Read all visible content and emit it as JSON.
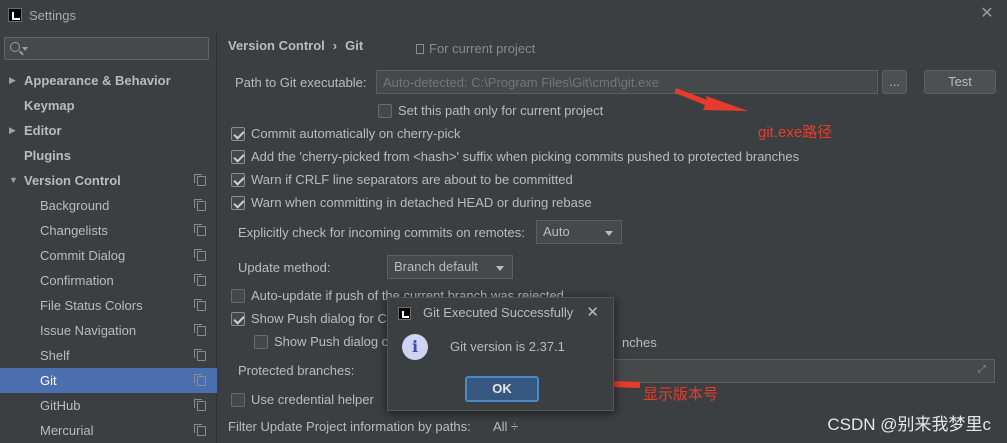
{
  "window": {
    "title": "Settings"
  },
  "search": {
    "placeholder": "",
    "value": ""
  },
  "sidebar": {
    "items": [
      {
        "label": "Appearance & Behavior",
        "bold": true,
        "arrow": "▶",
        "child": false,
        "icon": false
      },
      {
        "label": "Keymap",
        "bold": true,
        "arrow": "",
        "child": false,
        "icon": false
      },
      {
        "label": "Editor",
        "bold": true,
        "arrow": "▶",
        "child": false,
        "icon": false
      },
      {
        "label": "Plugins",
        "bold": true,
        "arrow": "",
        "child": false,
        "icon": false
      },
      {
        "label": "Version Control",
        "bold": true,
        "arrow": "▼",
        "child": false,
        "icon": true
      },
      {
        "label": "Background",
        "bold": false,
        "arrow": "",
        "child": true,
        "icon": true
      },
      {
        "label": "Changelists",
        "bold": false,
        "arrow": "",
        "child": true,
        "icon": true
      },
      {
        "label": "Commit Dialog",
        "bold": false,
        "arrow": "",
        "child": true,
        "icon": true
      },
      {
        "label": "Confirmation",
        "bold": false,
        "arrow": "",
        "child": true,
        "icon": true
      },
      {
        "label": "File Status Colors",
        "bold": false,
        "arrow": "",
        "child": true,
        "icon": true
      },
      {
        "label": "Issue Navigation",
        "bold": false,
        "arrow": "",
        "child": true,
        "icon": true
      },
      {
        "label": "Shelf",
        "bold": false,
        "arrow": "",
        "child": true,
        "icon": true
      },
      {
        "label": "Git",
        "bold": false,
        "arrow": "",
        "child": true,
        "icon": true,
        "selected": true
      },
      {
        "label": "GitHub",
        "bold": false,
        "arrow": "",
        "child": true,
        "icon": true
      },
      {
        "label": "Mercurial",
        "bold": false,
        "arrow": "",
        "child": true,
        "icon": true
      }
    ]
  },
  "breadcrumb": {
    "part1": "Version Control",
    "sep": "›",
    "part2": "Git"
  },
  "scope": {
    "label": "For current project"
  },
  "git_path": {
    "label": "Path to Git executable:",
    "placeholder": "Auto-detected: C:\\Program Files\\Git\\cmd\\git.exe",
    "browse_label": "...",
    "test_label": "Test",
    "only_current_label": "Set this path only for current project"
  },
  "options": {
    "cherry_pick": "Commit automatically on cherry-pick",
    "hash_suffix": "Add the 'cherry-picked from <hash>' suffix when picking commits pushed to protected branches",
    "crlf": "Warn if CRLF line separators are about to be committed",
    "detached": "Warn when committing in detached HEAD or during rebase",
    "incoming_label": "Explicitly check for incoming commits on remotes:",
    "incoming_value": "Auto",
    "update_method_label": "Update method:",
    "update_method_value": "Branch default",
    "auto_update": "Auto-update if push of the current branch was rejected",
    "show_push": "Show Push dialog for C",
    "show_push_protected": "Show Push dialog c",
    "show_push_protected_tail": "nches",
    "protected_label": "Protected branches:",
    "credential": "Use credential helper",
    "filter_label": "Filter Update Project information by paths:",
    "filter_value": "All ÷"
  },
  "annotations": {
    "git_path_note": "git.exe路径",
    "version_note": "显示版本号"
  },
  "dialog": {
    "title": "Git Executed Successfully",
    "message": "Git version is 2.37.1",
    "ok_label": "OK"
  },
  "watermark": "CSDN @别来我梦里c",
  "colors": {
    "accent": "#4b6eaf",
    "annotation": "#e83b2c",
    "background": "#3c3f41"
  }
}
